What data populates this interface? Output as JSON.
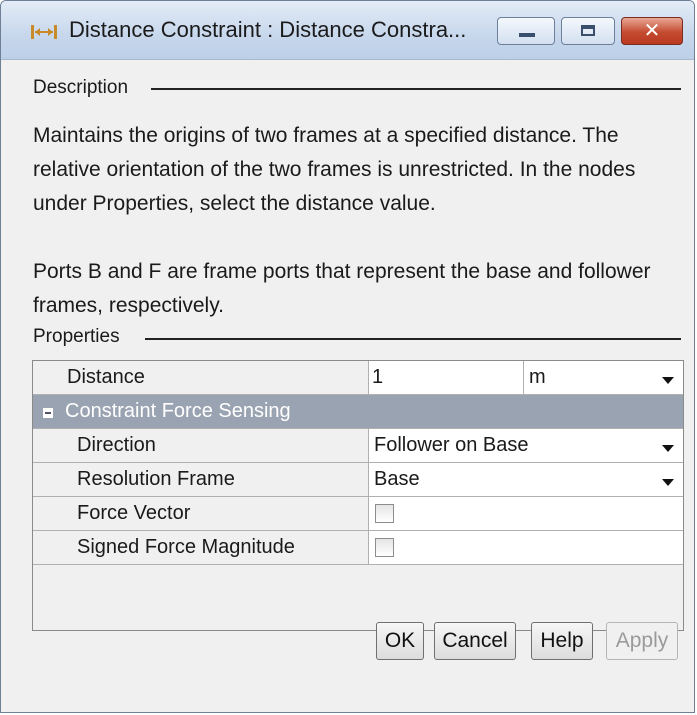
{
  "window": {
    "title": "Distance Constraint : Distance Constra...",
    "icon": "distance-constraint-icon",
    "close_color": "#c44b30"
  },
  "description": {
    "label": "Description",
    "paragraph1": "Maintains the origins of two frames at a specified distance. The relative orientation of the two frames is unrestricted. In the nodes under Properties, select the distance value.",
    "paragraph2": "Ports B and F are frame ports that represent the base and follower frames, respectively."
  },
  "properties": {
    "label": "Properties",
    "distance": {
      "name": "Distance",
      "value": "1",
      "unit": "m"
    },
    "group": {
      "name": "Constraint Force Sensing",
      "expanded": true
    },
    "direction": {
      "name": "Direction",
      "value": "Follower on Base"
    },
    "resolution_frame": {
      "name": "Resolution Frame",
      "value": "Base"
    },
    "force_vector": {
      "name": "Force Vector",
      "checked": false
    },
    "signed_force_magnitude": {
      "name": "Signed Force Magnitude",
      "checked": false
    }
  },
  "buttons": {
    "ok": "OK",
    "cancel": "Cancel",
    "help": "Help",
    "apply": "Apply"
  }
}
